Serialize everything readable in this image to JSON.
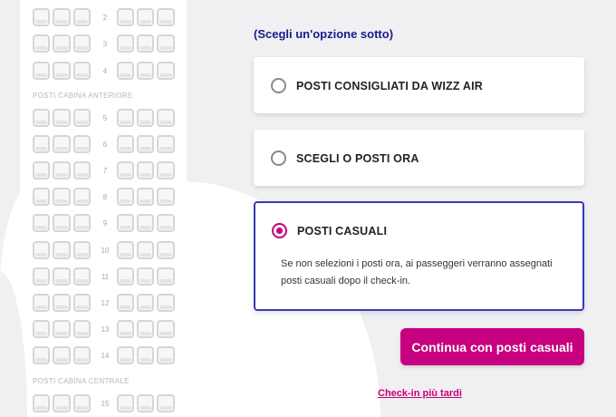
{
  "seatmap": {
    "rows": [
      {
        "num": "2"
      },
      {
        "num": "3"
      },
      {
        "num": "4"
      },
      {
        "num": "5"
      },
      {
        "num": "6"
      },
      {
        "num": "7"
      },
      {
        "num": "8"
      },
      {
        "num": "9"
      },
      {
        "num": "10"
      },
      {
        "num": "11"
      },
      {
        "num": "12"
      },
      {
        "num": "13"
      },
      {
        "num": "14"
      },
      {
        "num": "15"
      }
    ],
    "section_front": "POSTI CABINA ANTERIORE",
    "section_center": "POSTI CABINA CENTRALE"
  },
  "prompt": "(Scegli un'opzione sotto)",
  "options": [
    {
      "label": "POSTI CONSIGLIATI DA WIZZ AIR",
      "selected": false
    },
    {
      "label": "SCEGLI O POSTI ORA",
      "selected": false
    },
    {
      "label": "POSTI CASUALI",
      "selected": true,
      "description": "Se non selezioni i posti ora, ai passeggeri verranno assegnati posti casuali dopo il check-in."
    }
  ],
  "cta_label": "Continua con posti casuali",
  "later_link": "Check-in più tardi",
  "colors": {
    "accent": "#c6007e",
    "selected_border": "#3a3ab8",
    "heading": "#1a1a8c"
  }
}
